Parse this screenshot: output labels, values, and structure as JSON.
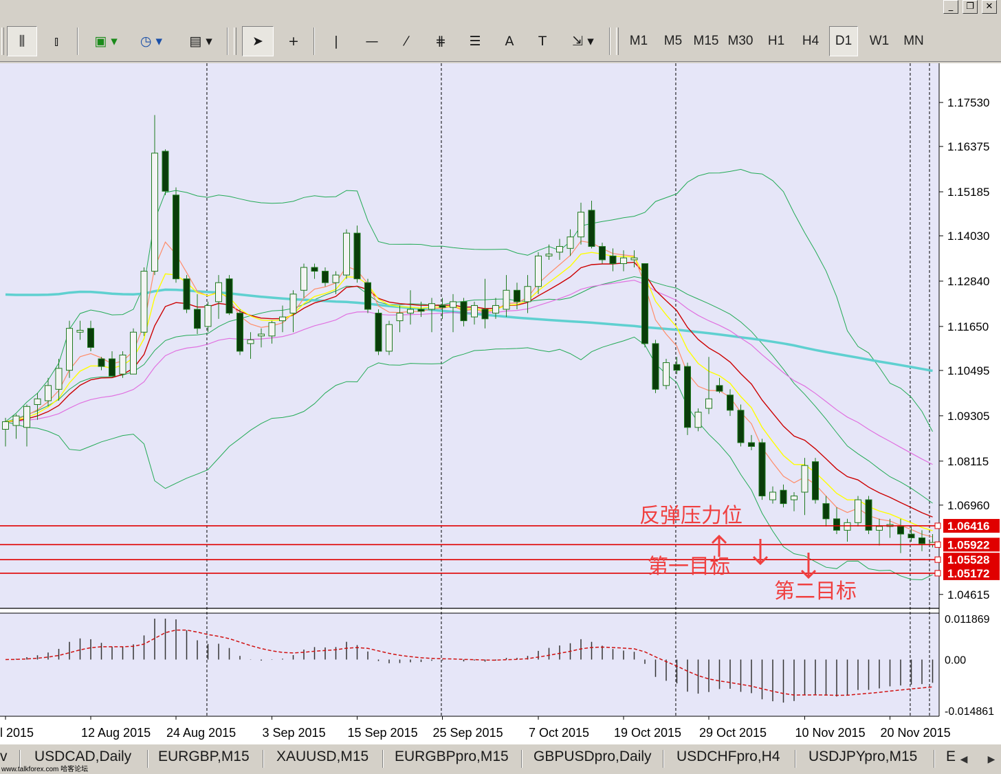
{
  "window": {
    "controls": [
      "minimize-icon",
      "restore-icon",
      "close-icon"
    ]
  },
  "toolbar": {
    "chart_buttons": [
      {
        "name": "bar-chart-icon",
        "glyph": "⫼",
        "pressed": true
      },
      {
        "name": "candles-icon",
        "glyph": "⫾",
        "pressed": false
      },
      {
        "name": "new-chart-icon",
        "glyph": "▣",
        "pressed": false
      },
      {
        "name": "clock-icon",
        "glyph": "◷",
        "pressed": false
      },
      {
        "name": "template-icon",
        "glyph": "▤",
        "pressed": false
      }
    ],
    "draw_buttons": [
      {
        "name": "cursor-icon",
        "glyph": "➤",
        "pressed": true
      },
      {
        "name": "crosshair-icon",
        "glyph": "+",
        "pressed": false
      },
      {
        "name": "vertical-line-icon",
        "glyph": "|",
        "pressed": false
      },
      {
        "name": "horizontal-line-icon",
        "glyph": "—",
        "pressed": false
      },
      {
        "name": "trendline-icon",
        "glyph": "⁄",
        "pressed": false
      },
      {
        "name": "fibo-channel-icon",
        "glyph": "⋕",
        "pressed": false
      },
      {
        "name": "fibo-retracement-icon",
        "glyph": "☰",
        "pressed": false
      },
      {
        "name": "text-icon",
        "glyph": "A",
        "pressed": false
      },
      {
        "name": "text-label-icon",
        "glyph": "T",
        "pressed": false
      },
      {
        "name": "arrows-icon",
        "glyph": "⇲",
        "pressed": false
      }
    ],
    "timeframes": [
      "M1",
      "M5",
      "M15",
      "M30",
      "H1",
      "H4",
      "D1",
      "W1",
      "MN"
    ],
    "active_timeframe": "D1"
  },
  "chart_data": {
    "type": "candlestick",
    "ylim": [
      1.0425,
      1.1856
    ],
    "y_ticks": [
      "1.17530",
      "1.16375",
      "1.15185",
      "1.14030",
      "1.12840",
      "1.11650",
      "1.10495",
      "1.09305",
      "1.08115",
      "1.06960",
      "1.04615"
    ],
    "x_ticks": [
      "l 2015",
      "12 Aug 2015",
      "24 Aug 2015",
      "3 Sep 2015",
      "15 Sep 2015",
      "25 Sep 2015",
      "7 Oct 2015",
      "19 Oct 2015",
      "29 Oct 2015",
      "10 Nov 2015",
      "20 Nov 2015"
    ],
    "period_separators_after_index": [
      18,
      40,
      62,
      84
    ],
    "candles": [
      {
        "o": 1.0895,
        "h": 1.0925,
        "l": 1.085,
        "c": 1.0915
      },
      {
        "o": 1.0905,
        "h": 1.0935,
        "l": 1.087,
        "c": 1.093
      },
      {
        "o": 1.09,
        "h": 1.096,
        "l": 1.085,
        "c": 1.0955
      },
      {
        "o": 1.096,
        "h": 1.099,
        "l": 1.092,
        "c": 1.0975
      },
      {
        "o": 1.097,
        "h": 1.103,
        "l": 1.0955,
        "c": 1.101
      },
      {
        "o": 1.1,
        "h": 1.108,
        "l": 1.097,
        "c": 1.1055
      },
      {
        "o": 1.105,
        "h": 1.118,
        "l": 1.103,
        "c": 1.116
      },
      {
        "o": 1.115,
        "h": 1.118,
        "l": 1.113,
        "c": 1.1155
      },
      {
        "o": 1.116,
        "h": 1.118,
        "l": 1.11,
        "c": 1.111
      },
      {
        "o": 1.108,
        "h": 1.1085,
        "l": 1.105,
        "c": 1.106
      },
      {
        "o": 1.108,
        "h": 1.11,
        "l": 1.104,
        "c": 1.1035
      },
      {
        "o": 1.104,
        "h": 1.11,
        "l": 1.103,
        "c": 1.109
      },
      {
        "o": 1.104,
        "h": 1.116,
        "l": 1.104,
        "c": 1.115
      },
      {
        "o": 1.115,
        "h": 1.132,
        "l": 1.114,
        "c": 1.131
      },
      {
        "o": 1.131,
        "h": 1.172,
        "l": 1.13,
        "c": 1.162
      },
      {
        "o": 1.1625,
        "h": 1.163,
        "l": 1.151,
        "c": 1.152
      },
      {
        "o": 1.151,
        "h": 1.153,
        "l": 1.128,
        "c": 1.129
      },
      {
        "o": 1.129,
        "h": 1.13,
        "l": 1.12,
        "c": 1.121
      },
      {
        "o": 1.121,
        "h": 1.125,
        "l": 1.1145,
        "c": 1.116
      },
      {
        "o": 1.1165,
        "h": 1.123,
        "l": 1.115,
        "c": 1.122
      },
      {
        "o": 1.123,
        "h": 1.13,
        "l": 1.1185,
        "c": 1.128
      },
      {
        "o": 1.129,
        "h": 1.13,
        "l": 1.1195,
        "c": 1.12
      },
      {
        "o": 1.12,
        "h": 1.121,
        "l": 1.109,
        "c": 1.11
      },
      {
        "o": 1.112,
        "h": 1.115,
        "l": 1.108,
        "c": 1.113
      },
      {
        "o": 1.114,
        "h": 1.116,
        "l": 1.111,
        "c": 1.1145
      },
      {
        "o": 1.114,
        "h": 1.118,
        "l": 1.112,
        "c": 1.1175
      },
      {
        "o": 1.118,
        "h": 1.122,
        "l": 1.115,
        "c": 1.119
      },
      {
        "o": 1.12,
        "h": 1.126,
        "l": 1.115,
        "c": 1.125
      },
      {
        "o": 1.126,
        "h": 1.133,
        "l": 1.124,
        "c": 1.132
      },
      {
        "o": 1.132,
        "h": 1.133,
        "l": 1.129,
        "c": 1.131
      },
      {
        "o": 1.131,
        "h": 1.132,
        "l": 1.127,
        "c": 1.128
      },
      {
        "o": 1.128,
        "h": 1.131,
        "l": 1.125,
        "c": 1.13
      },
      {
        "o": 1.13,
        "h": 1.142,
        "l": 1.129,
        "c": 1.141
      },
      {
        "o": 1.141,
        "h": 1.143,
        "l": 1.128,
        "c": 1.129
      },
      {
        "o": 1.128,
        "h": 1.129,
        "l": 1.12,
        "c": 1.121
      },
      {
        "o": 1.12,
        "h": 1.121,
        "l": 1.109,
        "c": 1.11
      },
      {
        "o": 1.11,
        "h": 1.118,
        "l": 1.109,
        "c": 1.117
      },
      {
        "o": 1.118,
        "h": 1.122,
        "l": 1.115,
        "c": 1.12
      },
      {
        "o": 1.12,
        "h": 1.126,
        "l": 1.117,
        "c": 1.121
      },
      {
        "o": 1.121,
        "h": 1.123,
        "l": 1.119,
        "c": 1.1205
      },
      {
        "o": 1.121,
        "h": 1.124,
        "l": 1.115,
        "c": 1.1225
      },
      {
        "o": 1.122,
        "h": 1.124,
        "l": 1.1185,
        "c": 1.1215
      },
      {
        "o": 1.1215,
        "h": 1.125,
        "l": 1.115,
        "c": 1.123
      },
      {
        "o": 1.123,
        "h": 1.124,
        "l": 1.1165,
        "c": 1.118
      },
      {
        "o": 1.119,
        "h": 1.123,
        "l": 1.117,
        "c": 1.122
      },
      {
        "o": 1.121,
        "h": 1.129,
        "l": 1.116,
        "c": 1.1185
      },
      {
        "o": 1.12,
        "h": 1.124,
        "l": 1.1185,
        "c": 1.122
      },
      {
        "o": 1.121,
        "h": 1.13,
        "l": 1.119,
        "c": 1.126
      },
      {
        "o": 1.126,
        "h": 1.128,
        "l": 1.121,
        "c": 1.123
      },
      {
        "o": 1.123,
        "h": 1.13,
        "l": 1.12,
        "c": 1.127
      },
      {
        "o": 1.127,
        "h": 1.136,
        "l": 1.125,
        "c": 1.135
      },
      {
        "o": 1.135,
        "h": 1.138,
        "l": 1.134,
        "c": 1.1355
      },
      {
        "o": 1.136,
        "h": 1.1395,
        "l": 1.134,
        "c": 1.1375
      },
      {
        "o": 1.137,
        "h": 1.142,
        "l": 1.135,
        "c": 1.14
      },
      {
        "o": 1.14,
        "h": 1.149,
        "l": 1.138,
        "c": 1.1465
      },
      {
        "o": 1.147,
        "h": 1.1495,
        "l": 1.137,
        "c": 1.1375
      },
      {
        "o": 1.1375,
        "h": 1.1385,
        "l": 1.133,
        "c": 1.134
      },
      {
        "o": 1.135,
        "h": 1.137,
        "l": 1.131,
        "c": 1.133
      },
      {
        "o": 1.133,
        "h": 1.1365,
        "l": 1.131,
        "c": 1.1345
      },
      {
        "o": 1.134,
        "h": 1.1365,
        "l": 1.132,
        "c": 1.1345
      },
      {
        "o": 1.133,
        "h": 1.133,
        "l": 1.111,
        "c": 1.112
      },
      {
        "o": 1.112,
        "h": 1.113,
        "l": 1.099,
        "c": 1.1
      },
      {
        "o": 1.101,
        "h": 1.108,
        "l": 1.1,
        "c": 1.107
      },
      {
        "o": 1.1065,
        "h": 1.1085,
        "l": 1.104,
        "c": 1.105
      },
      {
        "o": 1.106,
        "h": 1.107,
        "l": 1.088,
        "c": 1.09
      },
      {
        "o": 1.09,
        "h": 1.095,
        "l": 1.089,
        "c": 1.094
      },
      {
        "o": 1.095,
        "h": 1.1085,
        "l": 1.0935,
        "c": 1.0975
      },
      {
        "o": 1.101,
        "h": 1.103,
        "l": 1.099,
        "c": 1.0995
      },
      {
        "o": 1.0985,
        "h": 1.1,
        "l": 1.093,
        "c": 1.0945
      },
      {
        "o": 1.0945,
        "h": 1.096,
        "l": 1.085,
        "c": 1.086
      },
      {
        "o": 1.086,
        "h": 1.088,
        "l": 1.084,
        "c": 1.085
      },
      {
        "o": 1.086,
        "h": 1.087,
        "l": 1.071,
        "c": 1.072
      },
      {
        "o": 1.071,
        "h": 1.0745,
        "l": 1.07,
        "c": 1.073
      },
      {
        "o": 1.0735,
        "h": 1.075,
        "l": 1.069,
        "c": 1.07
      },
      {
        "o": 1.071,
        "h": 1.073,
        "l": 1.068,
        "c": 1.072
      },
      {
        "o": 1.073,
        "h": 1.082,
        "l": 1.067,
        "c": 1.08
      },
      {
        "o": 1.081,
        "h": 1.082,
        "l": 1.07,
        "c": 1.071
      },
      {
        "o": 1.07,
        "h": 1.072,
        "l": 1.064,
        "c": 1.066
      },
      {
        "o": 1.066,
        "h": 1.069,
        "l": 1.062,
        "c": 1.063
      },
      {
        "o": 1.063,
        "h": 1.066,
        "l": 1.06,
        "c": 1.065
      },
      {
        "o": 1.065,
        "h": 1.072,
        "l": 1.064,
        "c": 1.071
      },
      {
        "o": 1.071,
        "h": 1.072,
        "l": 1.062,
        "c": 1.063
      },
      {
        "o": 1.063,
        "h": 1.066,
        "l": 1.059,
        "c": 1.064
      },
      {
        "o": 1.064,
        "h": 1.066,
        "l": 1.061,
        "c": 1.0645
      },
      {
        "o": 1.064,
        "h": 1.066,
        "l": 1.057,
        "c": 1.062
      },
      {
        "o": 1.062,
        "h": 1.064,
        "l": 1.06,
        "c": 1.061
      },
      {
        "o": 1.061,
        "h": 1.063,
        "l": 1.0575,
        "c": 1.0595
      },
      {
        "o": 1.0592,
        "h": 1.062,
        "l": 1.0585,
        "c": 1.0598
      }
    ],
    "indicators": {
      "long_ma_color": "#5fd0d0",
      "short_ma_colors": [
        "#ffff00",
        "#ff8c69",
        "#cc0000",
        "#e070e0"
      ],
      "bollinger_color": "#22aa55"
    },
    "horizontal_levels": [
      {
        "price": "1.06416",
        "color": "#e00000"
      },
      {
        "price": "1.05922",
        "color": "#e00000"
      },
      {
        "price": "1.05528",
        "color": "#e00000"
      },
      {
        "price": "1.05172",
        "color": "#e00000"
      }
    ],
    "annotations": [
      {
        "text": "反弹压力位",
        "color": "#f04040"
      },
      {
        "text": "第一目标",
        "color": "#f04040"
      },
      {
        "text": "第二目标",
        "color": "#f04040"
      }
    ],
    "oscillator": {
      "labels": [
        "0.011869",
        "0.00",
        "-0.014861"
      ],
      "range": [
        -0.014861,
        0.011869
      ]
    }
  },
  "tabs": [
    {
      "label": "v"
    },
    {
      "label": "USDCAD,Daily"
    },
    {
      "label": "EURGBP,M15"
    },
    {
      "label": "XAUUSD,M15"
    },
    {
      "label": "EURGBPpro,M15"
    },
    {
      "label": "GBPUSDpro,Daily"
    },
    {
      "label": "USDCHFpro,H4"
    },
    {
      "label": "USDJPYpro,M15"
    },
    {
      "label": "E"
    }
  ],
  "tab_nav": [
    "◀",
    "▶"
  ],
  "watermark": "www.talkforex.com 哈客论坛"
}
